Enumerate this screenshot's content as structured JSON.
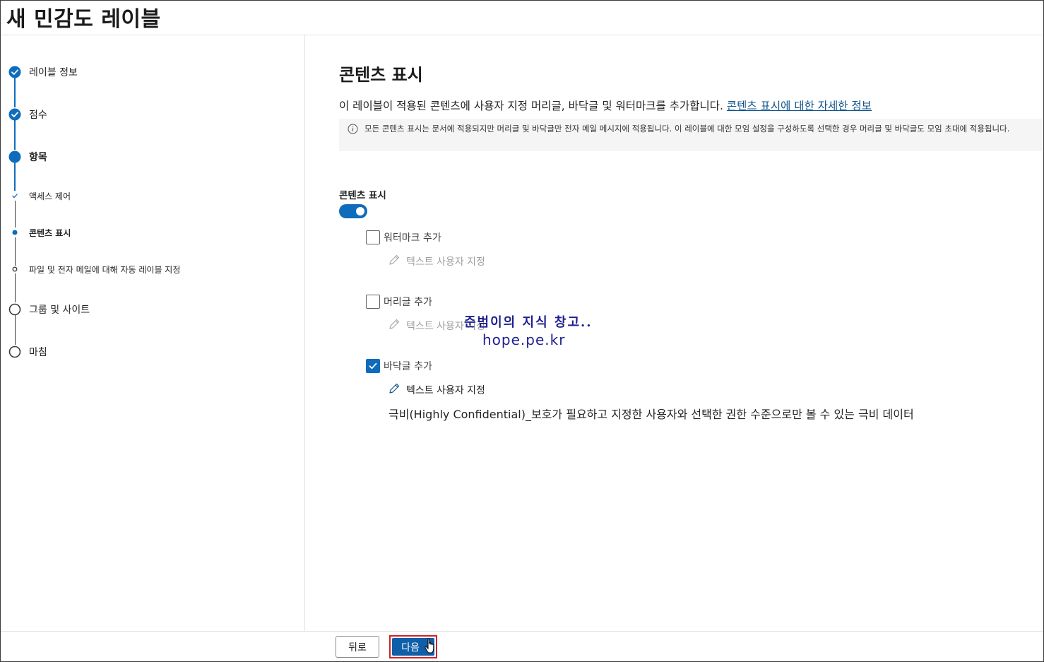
{
  "page_title": "새 민감도 레이블",
  "steps": [
    {
      "label": "레이블 정보",
      "state": "completed"
    },
    {
      "label": "점수",
      "state": "completed"
    },
    {
      "label": "항목",
      "state": "current"
    },
    {
      "label": "액세스 제어",
      "state": "sub-completed"
    },
    {
      "label": "콘텐츠 표시",
      "state": "sub-current"
    },
    {
      "label": "파일 및 전자 메일에 대해 자동 레이블 지정",
      "state": "sub-pending"
    },
    {
      "label": "그룹 및 사이트",
      "state": "pending"
    },
    {
      "label": "마침",
      "state": "pending"
    }
  ],
  "main": {
    "heading": "콘텐츠 표시",
    "intro_text": "이 레이블이 적용된 콘텐츠에 사용자 지정 머리글, 바닥글 및 워터마크를 추가합니다. ",
    "intro_link": "콘텐츠 표시에 대한 자세한 정보",
    "notice": "모든 콘텐츠 표시는 문서에 적용되지만 머리글 및 바닥글만 전자 메일 메시지에 적용됩니다. 이 레이블에 대한 모임 설정을 구성하도록 선택한 경우 머리글 및 바닥글도 모임 초대에 적용됩니다.",
    "toggle_label": "콘텐츠 표시",
    "toggle_on": true,
    "options": [
      {
        "label": "워터마크 추가",
        "checked": false,
        "edit_label": "텍스트 사용자 지정"
      },
      {
        "label": "머리글 추가",
        "checked": false,
        "edit_label": "텍스트 사용자 지정"
      },
      {
        "label": "바닥글 추가",
        "checked": true,
        "edit_label": "텍스트 사용자 지정"
      }
    ],
    "footer_value": "극비(Highly Confidential)_보호가 필요하고 지정한 사용자와 선택한 권한 수준으로만 볼 수 있는 극비 데이터"
  },
  "watermark": {
    "line1": "준범이의 지식 창고..",
    "line2": "hope.pe.kr"
  },
  "footer": {
    "back_label": "뒤로",
    "next_label": "다음"
  },
  "colors": {
    "accent": "#0f6cbd",
    "highlight_border": "#d0202a",
    "watermark": "#1f1f8f"
  }
}
